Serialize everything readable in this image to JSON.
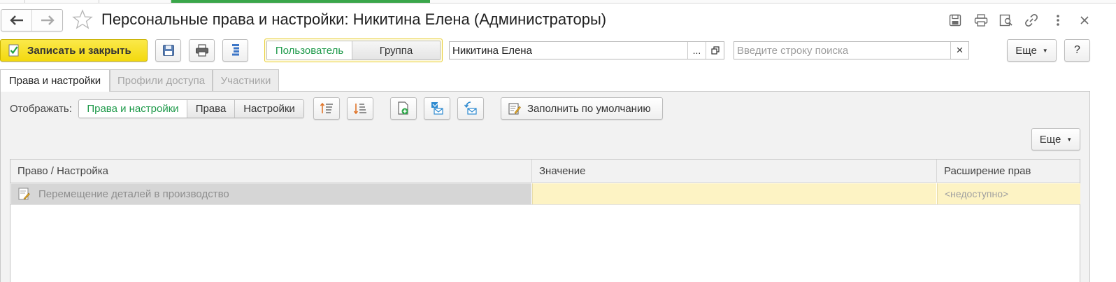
{
  "window": {
    "title": "Персональные права и настройки: Никитина Елена (Администраторы)"
  },
  "toolbar": {
    "save_close_label": "Записать и закрыть",
    "mode_options": [
      "Пользователь",
      "Группа"
    ],
    "mode_selected": "Пользователь",
    "user_value": "Никитина Елена",
    "select_button_label": "...",
    "search_placeholder": "Введите строку поиска",
    "search_clear_label": "×",
    "more_label": "Еще",
    "help_label": "?"
  },
  "tabs": [
    {
      "label": "Права и настройки",
      "active": true
    },
    {
      "label": "Профили доступа",
      "active": false
    },
    {
      "label": "Участники",
      "active": false
    }
  ],
  "panel": {
    "show_label": "Отображать:",
    "view_options": [
      "Права и настройки",
      "Права",
      "Настройки"
    ],
    "view_selected": "Права и настройки",
    "fill_default_label": "Заполнить по умолчанию",
    "more_label": "Еще"
  },
  "table": {
    "columns": [
      "Право / Настройка",
      "Значение",
      "Расширение прав"
    ],
    "rows": [
      {
        "name": "Перемещение деталей в производство",
        "value": "",
        "extension": "<недоступно>"
      }
    ]
  },
  "colors": {
    "accent_green": "#1e9a4a",
    "primary_button": "#f5dc1c",
    "highlight_row": "#fdf3c4",
    "selected_row": "#d6d6d6"
  },
  "icons": {
    "back": "arrow-left-icon",
    "forward": "arrow-right-icon",
    "favorite": "star-icon",
    "save": "floppy-disk-icon",
    "print": "printer-icon",
    "report": "list-report-icon",
    "window_icons": [
      "floppy-disk-icon",
      "printer-icon",
      "preview-icon",
      "link-icon",
      "more-vertical-icon",
      "close-icon"
    ]
  }
}
